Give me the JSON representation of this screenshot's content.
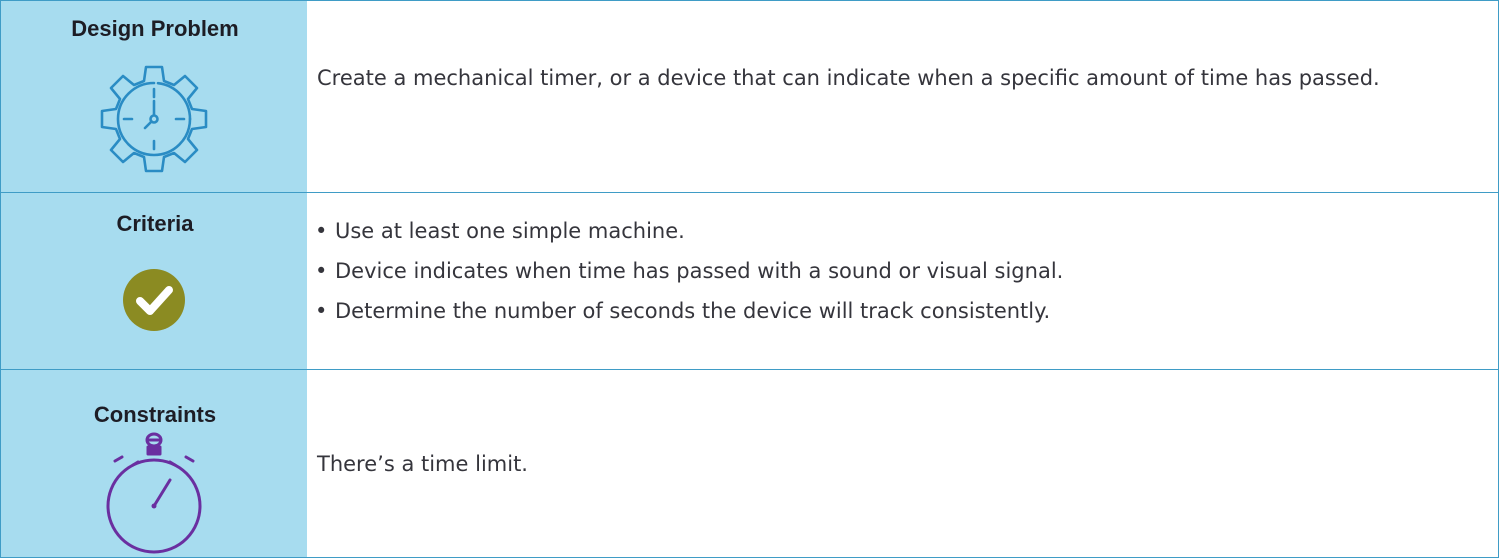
{
  "rows": [
    {
      "label": "Design Problem",
      "icon": "gear-clock-icon",
      "text": "Create a mechanical timer, or a device that can indicate when a specific amount of time has passed."
    },
    {
      "label": "Criteria",
      "icon": "checkmark-circle-icon",
      "bullets": [
        "Use at least one simple machine.",
        "Device indicates when time has passed with a sound or visual signal.",
        "Determine the number of seconds the device will track consistently."
      ]
    },
    {
      "label": "Constraints",
      "icon": "stopwatch-icon",
      "text": "There’s a time limit."
    }
  ],
  "colors": {
    "label_bg": "#a7dcef",
    "border": "#3f9cc6",
    "gear_icon": "#2a8cc4",
    "check_icon": "#8b8b22",
    "stopwatch_icon": "#6a2fa0"
  }
}
